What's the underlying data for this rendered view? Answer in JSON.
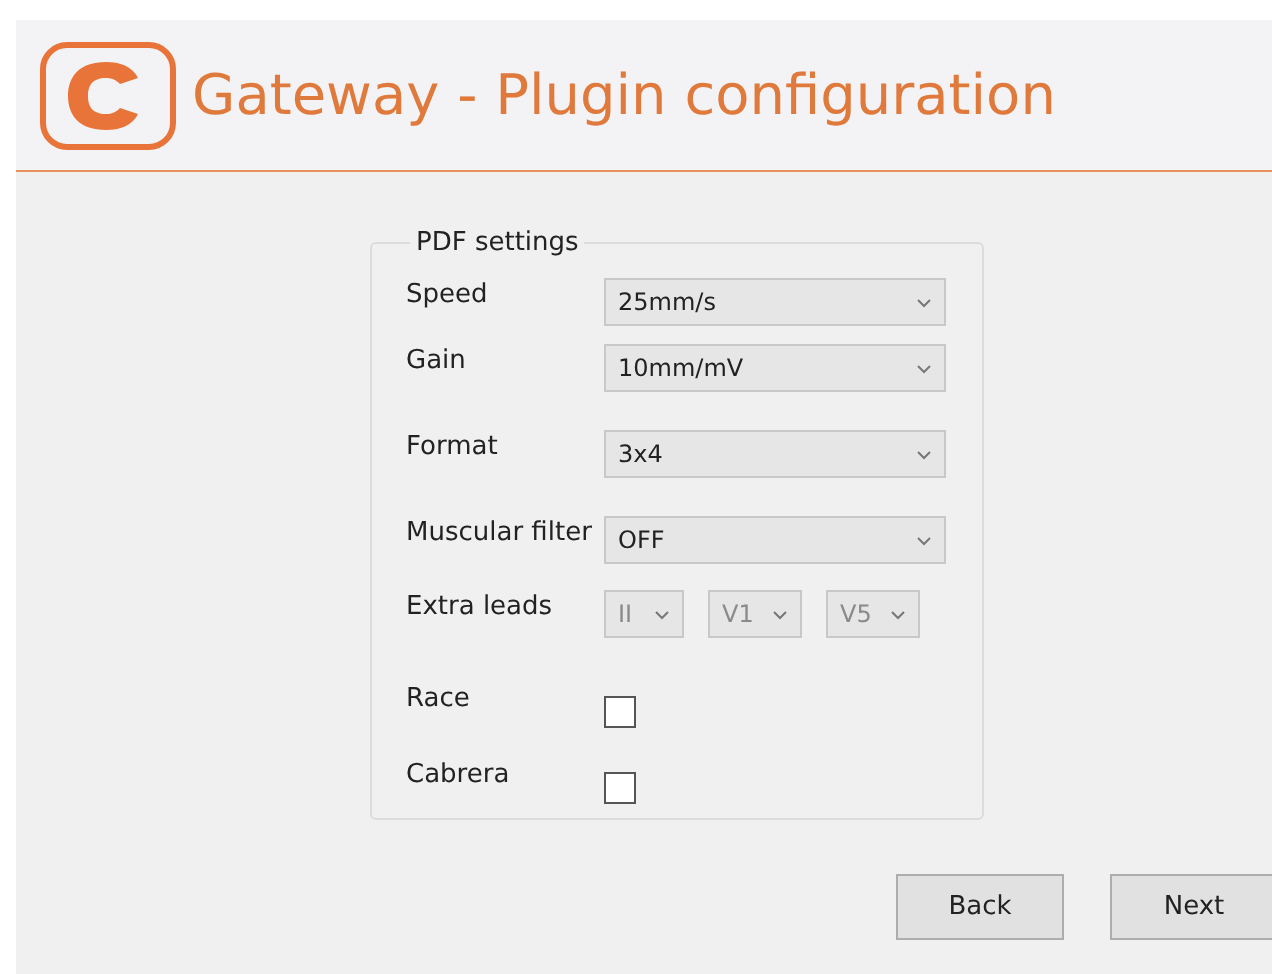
{
  "header": {
    "title": "Gateway - Plugin configuration"
  },
  "group": {
    "title": "PDF settings",
    "rows": [
      {
        "kind": "select",
        "label": "Speed",
        "value": "25mm/s"
      },
      {
        "kind": "select",
        "label": "Gain",
        "value": "10mm/mV"
      },
      {
        "kind": "select",
        "label": "Format",
        "value": "3x4"
      },
      {
        "kind": "select",
        "label": "Muscular filter",
        "value": "OFF"
      },
      {
        "kind": "multi",
        "label": "Extra leads",
        "selects": [
          {
            "value": "II",
            "disabled": true
          },
          {
            "value": "V1",
            "disabled": true
          },
          {
            "value": "V5",
            "disabled": true
          }
        ]
      },
      {
        "kind": "checkbox",
        "label": "Race",
        "checked": false
      },
      {
        "kind": "checkbox",
        "label": "Cabrera",
        "checked": false
      }
    ]
  },
  "buttons": [
    "Back",
    "Next"
  ]
}
